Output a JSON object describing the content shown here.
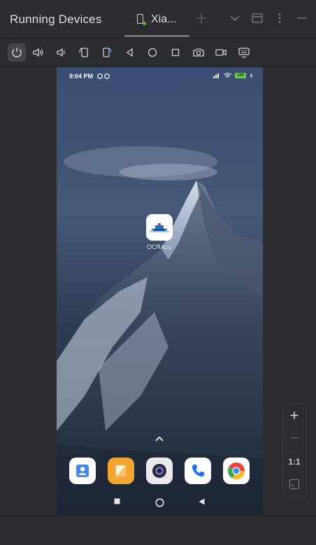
{
  "panel": {
    "title": "Running Devices"
  },
  "tab": {
    "label": "Xia..."
  },
  "toolbar": {
    "tools": [
      "power",
      "volume-up",
      "volume-down",
      "rotate-left",
      "rotate-right",
      "back",
      "home",
      "overview",
      "screenshot",
      "screen-record",
      "keyboard"
    ]
  },
  "device": {
    "status_time": "9:04 PM",
    "battery": "100",
    "home_app_label": "OCRApp",
    "dock_apps": [
      "contacts",
      "notes",
      "camera",
      "phone",
      "chrome"
    ]
  },
  "zoom": {
    "plus": "+",
    "minus": "−",
    "one_to_one": "1:1"
  },
  "colors": {
    "background": "#2b2d30",
    "active_dot": "#5fb832",
    "battery": "#6ad04a"
  }
}
